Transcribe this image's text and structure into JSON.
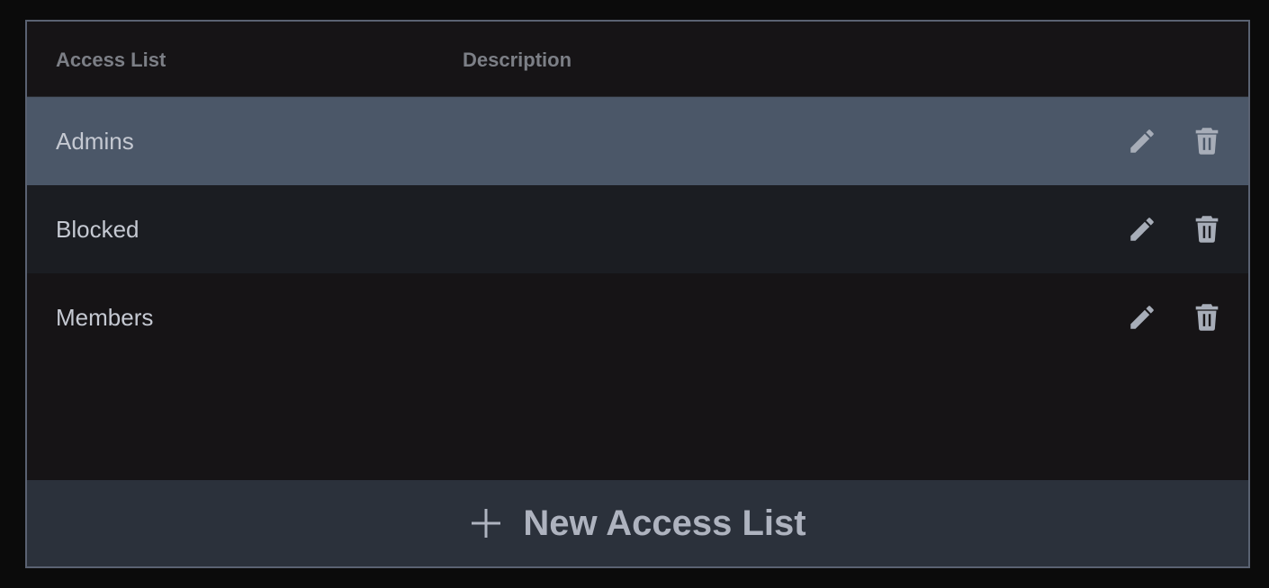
{
  "table": {
    "columns": [
      "Access List",
      "Description"
    ],
    "rows": [
      {
        "name": "Admins",
        "description": "",
        "selected": true
      },
      {
        "name": "Blocked",
        "description": "",
        "selected": false
      },
      {
        "name": "Members",
        "description": "",
        "selected": false
      }
    ],
    "actions": {
      "edit_icon": "pencil-icon",
      "delete_icon": "trash-icon"
    }
  },
  "footer": {
    "new_button_icon": "plus-icon",
    "new_button_label": "New Access List"
  },
  "colors": {
    "selected_row": "#4b5768",
    "panel_border": "#5a6272",
    "footer_bg": "#2b313b"
  }
}
